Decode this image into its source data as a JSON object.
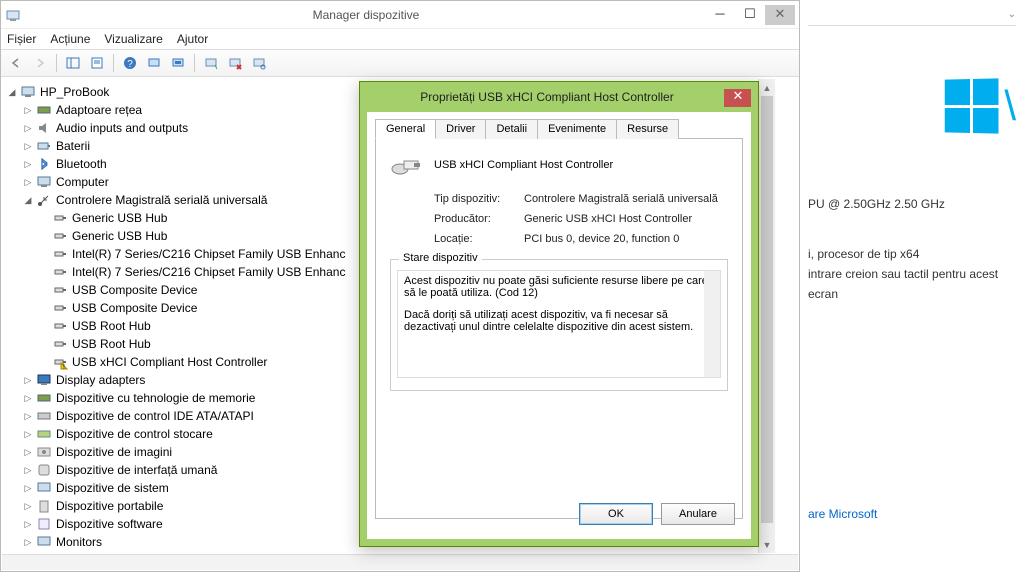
{
  "window": {
    "title": "Manager dispozitive"
  },
  "menu": {
    "file": "Fișier",
    "action": "Acțiune",
    "view": "Vizualizare",
    "help": "Ajutor"
  },
  "tree": {
    "root": "HP_ProBook",
    "nodes": [
      "Adaptoare rețea",
      "Audio inputs and outputs",
      "Baterii",
      "Bluetooth",
      "Computer"
    ],
    "usb_category": "Controlere Magistrală serială universală",
    "usb_children": [
      "Generic USB Hub",
      "Generic USB Hub",
      "Intel(R) 7 Series/C216 Chipset Family USB Enhanc",
      "Intel(R) 7 Series/C216 Chipset Family USB Enhanc",
      "USB Composite Device",
      "USB Composite Device",
      "USB Root Hub",
      "USB Root Hub",
      "USB xHCI Compliant Host Controller"
    ],
    "nodes_after": [
      "Display adapters",
      "Dispozitive cu tehnologie de memorie",
      "Dispozitive de control IDE ATA/ATAPI",
      "Dispozitive de control stocare",
      "Dispozitive de imagini",
      "Dispozitive de interfață umană",
      "Dispozitive de sistem",
      "Dispozitive portabile",
      "Dispozitive software",
      "Monitors"
    ]
  },
  "dialog": {
    "title": "Proprietăți USB xHCI Compliant Host Controller",
    "tabs": {
      "general": "General",
      "driver": "Driver",
      "details": "Detalii",
      "events": "Evenimente",
      "resources": "Resurse"
    },
    "device_name": "USB xHCI Compliant Host Controller",
    "labels": {
      "type": "Tip dispozitiv:",
      "vendor": "Producător:",
      "location": "Locație:"
    },
    "values": {
      "type": "Controlere Magistrală serială universală",
      "vendor": "Generic USB xHCI Host Controller",
      "location": "PCI bus 0, device 20, function 0"
    },
    "status_label": "Stare dispozitiv",
    "status_text_1": "Acest dispozitiv nu poate găsi suficiente resurse libere pe care să le poată utiliza. (Cod 12)",
    "status_text_2": "Dacă doriți să utilizați acest dispozitiv, va fi necesar să dezactivați unul dintre celelalte dispozitive din acest sistem.",
    "ok": "OK",
    "cancel": "Anulare"
  },
  "side": {
    "cpu": "PU @ 2.50GHz  2.50 GHz",
    "arch": "i, procesor de tip x64",
    "touch": "intrare creion sau tactil pentru acest ecran",
    "link": "are Microsoft"
  }
}
